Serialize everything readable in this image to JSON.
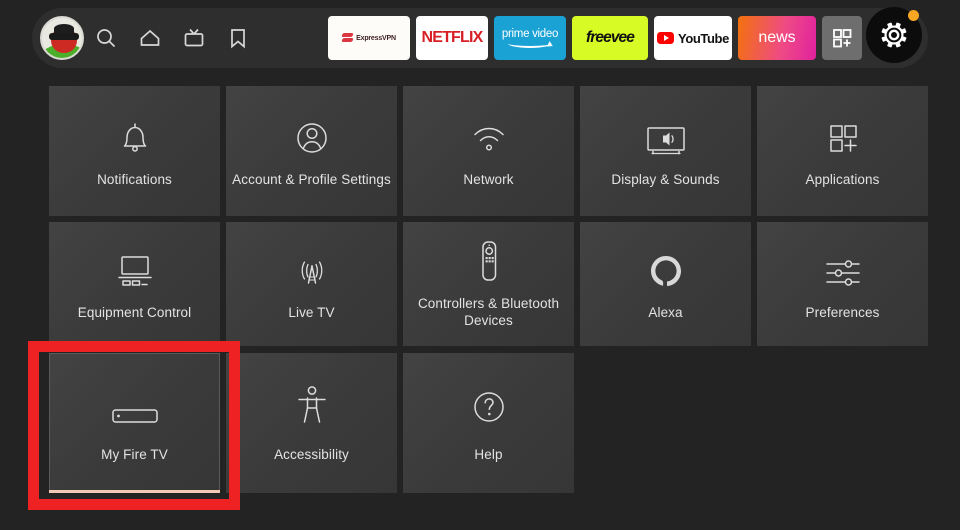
{
  "header": {
    "avatar": {
      "name": "user-avatar"
    },
    "nav_icons": [
      {
        "name": "search-icon",
        "label": "Search"
      },
      {
        "name": "home-icon",
        "label": "Home"
      },
      {
        "name": "live-tv-icon",
        "label": "Live"
      },
      {
        "name": "bookmark-icon",
        "label": "Watchlist"
      }
    ],
    "apps": [
      {
        "name": "expressvpn",
        "label": "ExpressVPN",
        "bg": "#fdfcf8"
      },
      {
        "name": "netflix",
        "label": "NETFLIX",
        "bg": "#ffffff",
        "fg": "#d81f26"
      },
      {
        "name": "prime-video",
        "label": "prime video",
        "bg": "#1aa2d4"
      },
      {
        "name": "freevee",
        "label": "freevee",
        "bg": "#d7fb24"
      },
      {
        "name": "youtube",
        "label": "YouTube",
        "bg": "#ffffff"
      },
      {
        "name": "news",
        "label": "news",
        "bg": "#ef4a86"
      },
      {
        "name": "app-library",
        "label": "",
        "bg": "#6e6e6e"
      }
    ],
    "settings_button": {
      "name": "settings-gear",
      "label": "Settings",
      "badge": true,
      "badge_color": "#f5a623"
    }
  },
  "grid": {
    "rows": [
      [
        {
          "icon": "bell-icon",
          "label": "Notifications"
        },
        {
          "icon": "person-circle-icon",
          "label": "Account & Profile Settings"
        },
        {
          "icon": "wifi-icon",
          "label": "Network"
        },
        {
          "icon": "tv-speaker-icon",
          "label": "Display & Sounds"
        },
        {
          "icon": "app-grid-plus-icon",
          "label": "Applications"
        }
      ],
      [
        {
          "icon": "monitor-equipment-icon",
          "label": "Equipment Control"
        },
        {
          "icon": "antenna-icon",
          "label": "Live TV"
        },
        {
          "icon": "remote-control-icon",
          "label": "Controllers & Bluetooth Devices"
        },
        {
          "icon": "alexa-ring-icon",
          "label": "Alexa"
        },
        {
          "icon": "sliders-icon",
          "label": "Preferences"
        }
      ],
      [
        {
          "icon": "fire-tv-stick-icon",
          "label": "My Fire TV",
          "selected": true
        },
        {
          "icon": "accessibility-icon",
          "label": "Accessibility"
        },
        {
          "icon": "question-circle-icon",
          "label": "Help"
        }
      ]
    ]
  },
  "highlight": {
    "name": "selection-highlight",
    "color": "#ee2222",
    "target_label": "My Fire TV"
  },
  "colors": {
    "background": "#232323",
    "tile": "#3b3b3b",
    "header_pill": "#2e2e2e",
    "text": "#e3e3e3",
    "highlight": "#ee2222"
  }
}
